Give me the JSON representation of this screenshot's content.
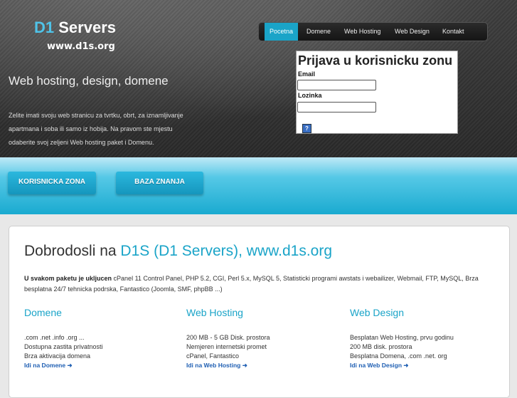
{
  "header": {
    "logo_d1": "D1",
    "logo_servers": "Servers",
    "logo_url": "www.d1s.org",
    "tagline": "Web hosting, design, domene",
    "intro": "Zelite imati svoju web stranicu za tvrtku, obrt, za iznamljivanje apartmana i soba ili samo iz hobija. Na pravom ste mjestu odaberite svoj zeljeni Web hosting paket i Domenu."
  },
  "nav": {
    "items": [
      {
        "label": "Pocetna",
        "active": true
      },
      {
        "label": "Domene"
      },
      {
        "label": "Web Hosting"
      },
      {
        "label": "Web Design"
      },
      {
        "label": "Kontakt"
      }
    ]
  },
  "login": {
    "title": "Prijava u korisnicku zonu",
    "email_label": "Email",
    "email_value": "",
    "password_label": "Lozinka",
    "password_value": "",
    "help_icon": "?"
  },
  "band": {
    "buttons": [
      "KORISNICKA ZONA",
      "BAZA ZNANJA"
    ]
  },
  "main": {
    "welcome_prefix": "Dobrodosli na ",
    "welcome_highlight": "D1S (D1 Servers), www.d1s.org",
    "packages_bold": "U svakom paketu je ukljucen",
    "packages_text": " cPanel 11 Control Panel, PHP 5.2, CGI, Perl 5.x, MySQL 5, Statisticki programi awstats i webailizer, Webmail, FTP, MySQL, Brza besplatna 24/7 tehnicka podrska, Fantastico (Joomla, SMF, phpBB ...)",
    "columns": [
      {
        "title": "Domene",
        "lines": [
          ".com .net .info .org ...",
          "Dostupna zastita privatnosti",
          "Brza aktivacija domena"
        ],
        "link": "Idi na Domene ➜"
      },
      {
        "title": "Web Hosting",
        "lines": [
          "200 MB - 5 GB Disk. prostora",
          "Nemjeren internetski promet",
          "cPanel, Fantastico"
        ],
        "link": "Idi na Web Hosting ➜"
      },
      {
        "title": "Web Design",
        "lines": [
          "Besplatan Web Hosting, prvu godinu",
          "200 MB disk. prostora",
          "Besplatna Domena, .com .net. org"
        ],
        "link": "Idi na Web Design ➜"
      }
    ]
  },
  "colors": {
    "accent": "#1aa4c8",
    "link": "#1f5fb3",
    "header_bg": "#333333"
  }
}
